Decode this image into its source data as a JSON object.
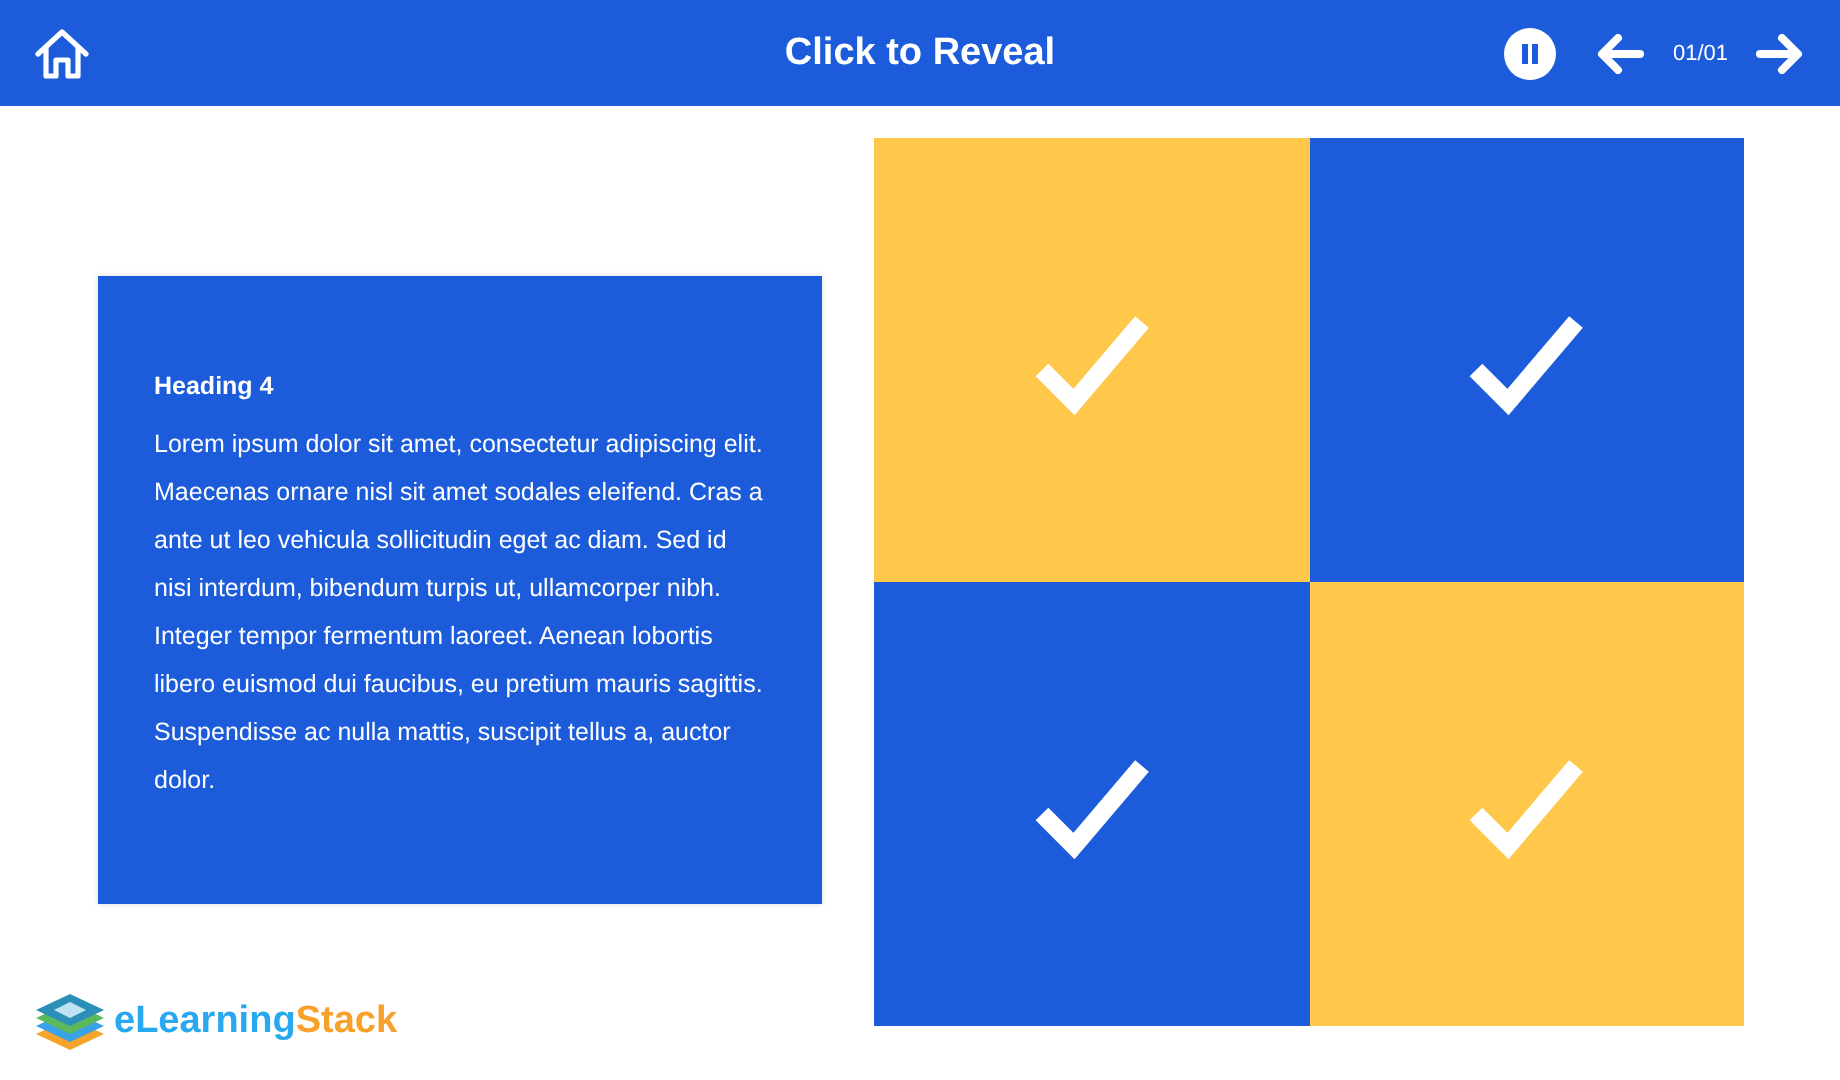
{
  "header": {
    "title": "Click to Reveal",
    "paused": false,
    "page_counter": "01/01"
  },
  "card": {
    "heading": "Heading 4",
    "body": "Lorem ipsum dolor sit amet, consectetur adipiscing elit. Maecenas ornare nisl sit amet sodales eleifend. Cras a ante ut leo vehicula sollicitudin eget ac diam. Sed id nisi interdum, bibendum turpis ut, ullamcorper nibh. Integer tempor fermentum laoreet. Aenean lobortis libero euismod dui faucibus, eu pretium mauris sagittis. Suspendisse ac nulla mattis, suscipit tellus a, auctor dolor."
  },
  "tiles": [
    {
      "color": "#ffc84a"
    },
    {
      "color": "#1c5cdb"
    },
    {
      "color": "#1c5cdb"
    },
    {
      "color": "#ffc84a"
    }
  ],
  "logo": {
    "first": "eLearning",
    "second": "Stack"
  }
}
